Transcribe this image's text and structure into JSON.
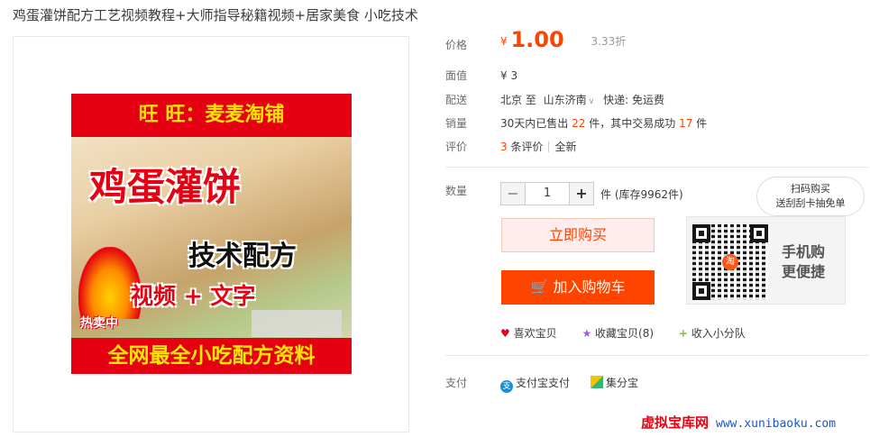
{
  "title": "鸡蛋灌饼配方工艺视频教程+大师指导秘籍视频+居家美食 小吃技术",
  "poster": {
    "top_text": "旺 旺：麦麦淘铺",
    "main_text": "鸡蛋灌饼",
    "tech_text": "技术配方",
    "video_text": "视频 + 文字",
    "hot_text": "热卖中",
    "bottom_text": "全网最全小吃配方资料"
  },
  "info": {
    "price_label": "价格",
    "currency": "¥",
    "price": "1.00",
    "discount": "3.33折",
    "face_label": "面值",
    "face_value": "¥ 3",
    "ship_label": "配送",
    "ship_from": "北京 至",
    "ship_to": "山东济南",
    "ship_method": "快递: 免运费",
    "sales_label": "销量",
    "sales_pre": "30天内已售出",
    "sales_count": "22",
    "sales_mid": "件，其中交易成功",
    "sales_success": "17",
    "sales_unit": "件",
    "review_label": "评价",
    "review_count": "3",
    "review_text": "条评价",
    "review_new": "全新",
    "qty_label": "数量",
    "qty_minus": "−",
    "qty_value": "1",
    "qty_plus": "+",
    "stock_text": "件 (库存9962件)",
    "buy_label": "立即购买",
    "cart_label": "加入购物车",
    "qr_line1": "手机购",
    "qr_line2": "更便捷",
    "qr_logo": "淘",
    "bubble_line1": "扫码购买",
    "bubble_line2": "送刮刮卡抽免单",
    "like_label": "喜欢宝贝",
    "collect_label": "收藏宝贝(8)",
    "add_label": "收入小分队",
    "pay_label": "支付",
    "alipay_label": "支付宝支付",
    "jifen_label": "集分宝"
  },
  "watermark": {
    "cn": "虚拟宝库网",
    "url": "www.xunibaoku.com"
  }
}
